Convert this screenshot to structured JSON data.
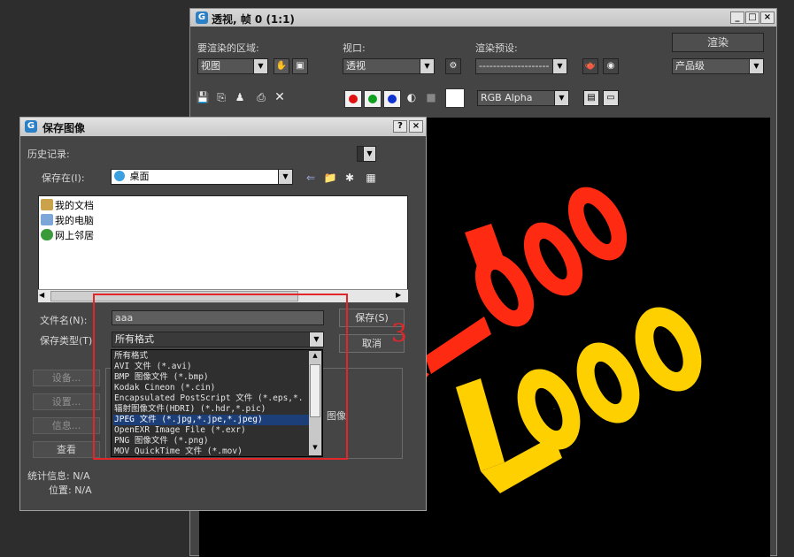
{
  "render_window": {
    "title": "透视, 帧 0 (1:1)",
    "render_area_label": "要渲染的区域:",
    "render_area_value": "视图",
    "viewport_label": "视口:",
    "viewport_value": "透视",
    "preset_label": "渲染预设:",
    "preset_value": "--------------------",
    "render_button": "渲染",
    "quality_value": "产品级",
    "channel_value": "RGB Alpha",
    "title_controls": [
      "_",
      "□",
      "×"
    ]
  },
  "render_scene": {
    "logo_red_text": "Logo",
    "logo_yellow_text": "Logo",
    "red_color": "#ff2a12",
    "yellow_color": "#ffd000"
  },
  "save_dialog": {
    "title": "保存图像",
    "help_button": "?",
    "close_button": "×",
    "history_label": "历史记录:",
    "save_in_label": "保存在(I):",
    "save_in_value": "桌面",
    "file_items": [
      {
        "label": "我的文档",
        "icon": "my-documents-icon"
      },
      {
        "label": "我的电脑",
        "icon": "my-computer-icon"
      },
      {
        "label": "网上邻居",
        "icon": "network-places-icon"
      }
    ],
    "filename_label": "文件名(N):",
    "filename_value": "aaa",
    "filetype_label": "保存类型(T):",
    "filetype_value": "所有格式",
    "save_button": "保存(S)",
    "cancel_button": "取消",
    "setup_button": "设备...",
    "settings_button": "设置...",
    "info_button": "信息...",
    "view_button": "查看",
    "stats_label": "统计信息: N/A",
    "location_label": "位置: N/A",
    "image_label": "图像",
    "file_types": [
      "所有格式",
      "AVI 文件 (*.avi)",
      "BMP 图像文件 (*.bmp)",
      "Kodak Cineon (*.cin)",
      "Encapsulated PostScript 文件 (*.eps,*.",
      "辐射图像文件(HDRI) (*.hdr,*.pic)",
      "JPEG 文件 (*.jpg,*.jpe,*.jpeg)",
      "OpenEXR Image File (*.exr)",
      "PNG 图像文件 (*.png)",
      "MOV QuickTime 文件 (*.mov)"
    ],
    "selected_file_type_index": 6
  },
  "annotation": {
    "number": "3",
    "color": "#e3262a"
  }
}
